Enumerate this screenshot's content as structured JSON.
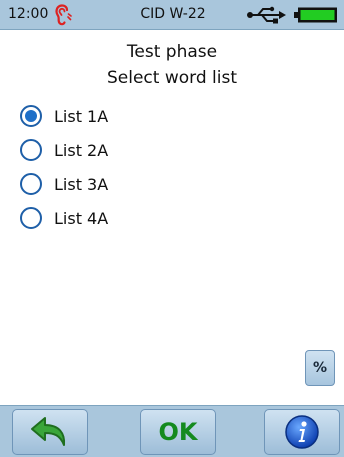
{
  "status_bar": {
    "time": "12:00",
    "title": "CID W-22",
    "icons": [
      "ear-icon",
      "usb-icon",
      "battery-icon"
    ],
    "battery_color": "#22cc22"
  },
  "heading": {
    "line1": "Test phase",
    "line2": "Select word list"
  },
  "word_lists": [
    {
      "label": "List 1A",
      "selected": true
    },
    {
      "label": "List 2A",
      "selected": false
    },
    {
      "label": "List 3A",
      "selected": false
    },
    {
      "label": "List 4A",
      "selected": false
    }
  ],
  "percent_button": {
    "label": "%"
  },
  "bottom_bar": {
    "back_icon": "back-arrow-icon",
    "ok_label": "OK",
    "info_icon": "info-icon"
  },
  "colors": {
    "bar_background": "#a9c6dc",
    "radio_accent": "#1e6fc8",
    "ok_green": "#148a1e"
  }
}
